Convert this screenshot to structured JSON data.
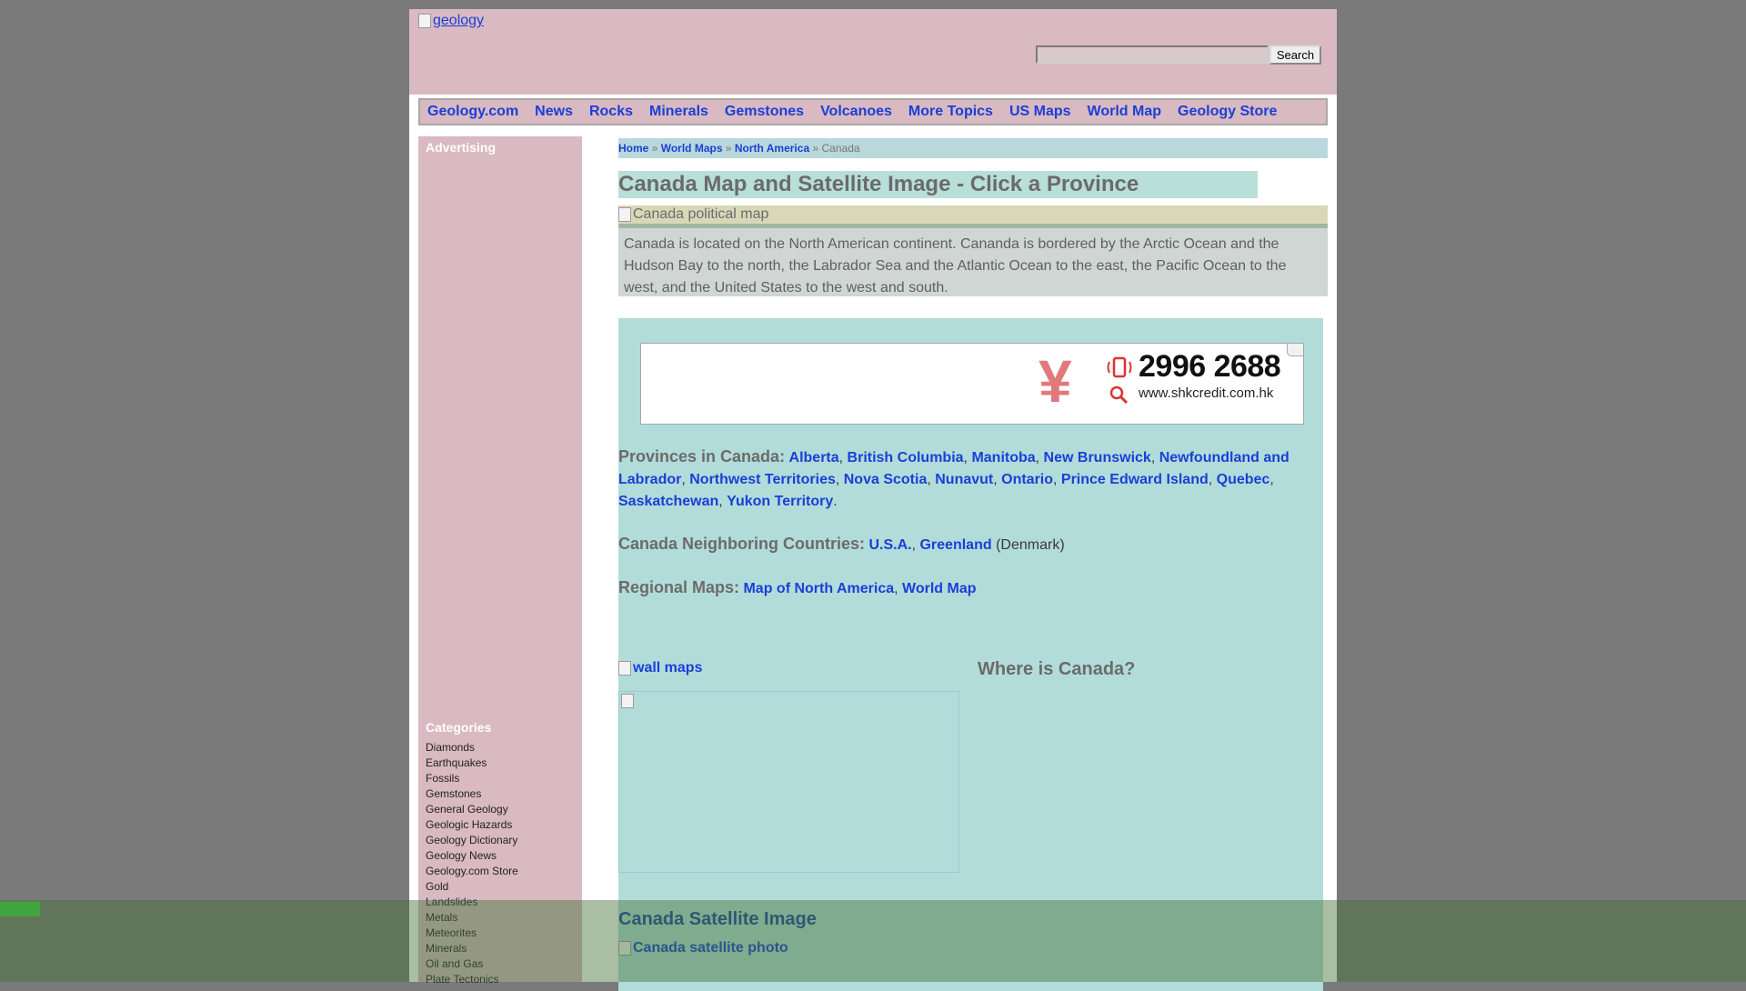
{
  "header": {
    "logo_alt": "geology",
    "search_placeholder": "",
    "search_button": "Search"
  },
  "nav": {
    "items": [
      "Geology.com",
      "News",
      "Rocks",
      "Minerals",
      "Gemstones",
      "Volcanoes",
      "More Topics",
      "US Maps",
      "World Map",
      "Geology Store"
    ]
  },
  "sidebar": {
    "advertising_heading": "Advertising",
    "categories_heading": "Categories",
    "categories": [
      "Diamonds",
      "Earthquakes",
      "Fossils",
      "Gemstones",
      "General Geology",
      "Geologic Hazards",
      "Geology Dictionary",
      "Geology News",
      "Geology.com Store",
      "Gold",
      "Landslides",
      "Metals",
      "Meteorites",
      "Minerals",
      "Oil and Gas",
      "Plate Tectonics"
    ]
  },
  "breadcrumb": {
    "home": "Home",
    "sep": "»",
    "world_maps": "World Maps",
    "north_america": "North America",
    "current": "Canada"
  },
  "main": {
    "title": "Canada Map and Satellite Image - Click a Province",
    "map_alt": "Canada political map",
    "intro": "Canada is located on the North American continent. Cananda is bordered by the Arctic Ocean and the Hudson Bay to the north, the Labrador Sea and the Atlantic Ocean to the east, the Pacific Ocean to the west, and the United States to the west and south.",
    "ad": {
      "phone": "2996 2688",
      "url": "www.shkcredit.com.hk"
    },
    "provinces_label": "Provinces in Canada:",
    "provinces": [
      "Alberta",
      "British Columbia",
      "Manitoba",
      "New Brunswick",
      "Newfoundland and Labrador",
      "Northwest Territories",
      "Nova Scotia",
      "Nunavut",
      "Ontario",
      "Prince Edward Island",
      "Quebec",
      "Saskatchewan",
      "Yukon Territory"
    ],
    "neighbors_label": "Canada Neighboring Countries:",
    "neighbors": [
      "U.S.A.",
      "Greenland"
    ],
    "neighbors_note": "(Denmark)",
    "regional_label": "Regional Maps:",
    "regional": [
      "Map of North America",
      "World Map"
    ],
    "wall_maps_alt": "wall maps",
    "where_heading": "Where is Canada?",
    "satellite_heading": "Canada Satellite Image",
    "satellite_alt": "Canada satellite photo"
  },
  "colors": {
    "link": "#1a3fd6",
    "header_bg": "#d9b9c2",
    "panel_bg": "#b2dcda"
  }
}
